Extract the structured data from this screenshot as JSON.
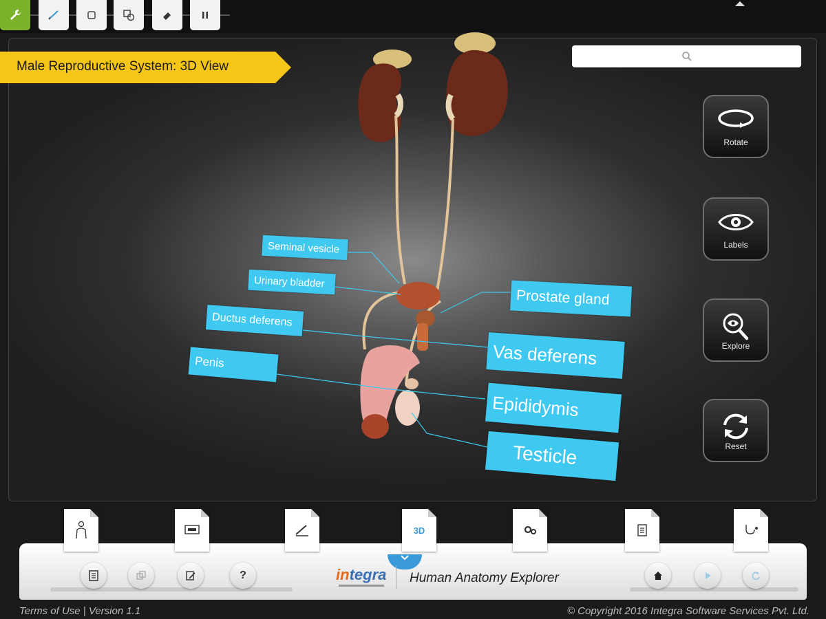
{
  "toolbar": {
    "tools": [
      {
        "icon": "wrench-icon",
        "active": true
      },
      {
        "icon": "pen-icon",
        "active": false
      },
      {
        "icon": "shape-icon",
        "active": false
      },
      {
        "icon": "shapes-icon",
        "active": false
      },
      {
        "icon": "eraser-icon",
        "active": false
      },
      {
        "icon": "pause-icon",
        "active": false
      }
    ]
  },
  "header": {
    "title": "Male Reproductive System: 3D View",
    "search_placeholder": ""
  },
  "side_controls": {
    "rotate": "Rotate",
    "labels": "Labels",
    "explore": "Explore",
    "reset": "Reset"
  },
  "labels": {
    "seminal_vesicle": "Seminal vesicle",
    "urinary_bladder": "Urinary bladder",
    "ductus_deferens": "Ductus deferens",
    "penis": "Penis",
    "prostate_gland": "Prostate gland",
    "vas_deferens": "Vas deferens",
    "epididymis": "Epididymis",
    "testicle": "Testicle"
  },
  "bottom_tabs": {
    "tab_3d": "3D"
  },
  "tray": {
    "help_label": "?",
    "logo_in": "in",
    "logo_tegra": "tegra",
    "app_name": "Human Anatomy Explorer"
  },
  "footer": {
    "left": "Terms of Use |  Version 1.1",
    "right": "© Copyright 2016 Integra Software Services Pvt. Ltd."
  },
  "colors": {
    "accent_green": "#7cb32a",
    "banner_yellow": "#f5c518",
    "label_blue": "#3fc8f0",
    "tab_blue": "#3a9ad9"
  }
}
